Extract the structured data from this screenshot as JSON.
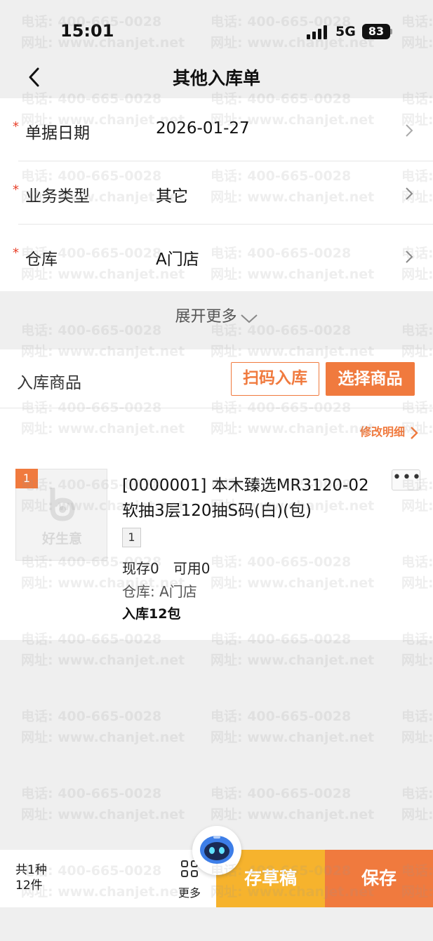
{
  "status": {
    "time": "15:01",
    "network": "5G",
    "battery": "83"
  },
  "nav": {
    "title": "其他入库单"
  },
  "form": {
    "rows": [
      {
        "label": "单据日期",
        "value": "2026-01-27"
      },
      {
        "label": "业务类型",
        "value": "其它"
      },
      {
        "label": "仓库",
        "value": "A门店"
      }
    ],
    "required_mark": "*",
    "expand_label": "展开更多"
  },
  "goods": {
    "title": "入库商品",
    "scan_label": "扫码入库",
    "select_label": "选择商品",
    "edit_detail_label": "修改明细",
    "item": {
      "index": "1",
      "thumbnail_text": "好生意",
      "name": "[0000001] 本木臻选MR3120-02软抽3层120抽S码(白)(包)",
      "more": "•••",
      "qty_tag": "1",
      "stock": "现存0",
      "available": "可用0",
      "warehouse": "仓库: A门店",
      "inbound": "入库12包"
    }
  },
  "watermark": {
    "line1": "电话: 400-665-0028",
    "line2": "网址: www.chanjet.net"
  },
  "bottom": {
    "summary_kinds": "共1种",
    "summary_count": "12件",
    "more_label": "更多",
    "draft_label": "存草稿",
    "save_label": "保存"
  },
  "colors": {
    "accent": "#f07a3e",
    "draft": "#f6b32d",
    "required": "#e8412a"
  }
}
